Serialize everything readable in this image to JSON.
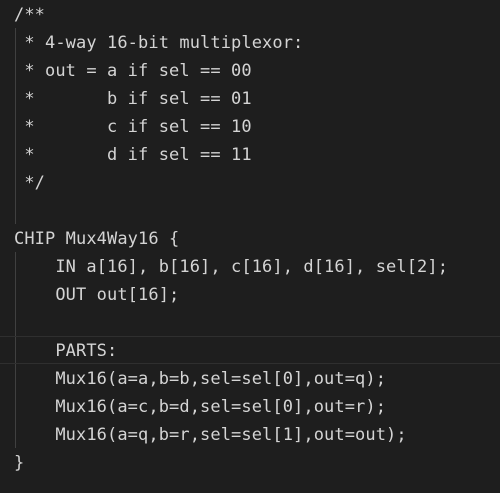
{
  "editor": {
    "lines": [
      "/**",
      " * 4-way 16-bit multiplexor:",
      " * out = a if sel == 00",
      " *       b if sel == 01",
      " *       c if sel == 10",
      " *       d if sel == 11",
      " */",
      "",
      "CHIP Mux4Way16 {",
      "    IN a[16], b[16], c[16], d[16], sel[2];",
      "    OUT out[16];",
      "",
      "    PARTS:",
      "    Mux16(a=a,b=b,sel=sel[0],out=q);",
      "    Mux16(a=c,b=d,sel=sel[0],out=r);",
      "    Mux16(a=q,b=r,sel=sel[1],out=out);",
      "}"
    ]
  },
  "colors": {
    "background": "#1e1e1e",
    "text": "#d4d4d4",
    "indent_guide": "#404040"
  }
}
